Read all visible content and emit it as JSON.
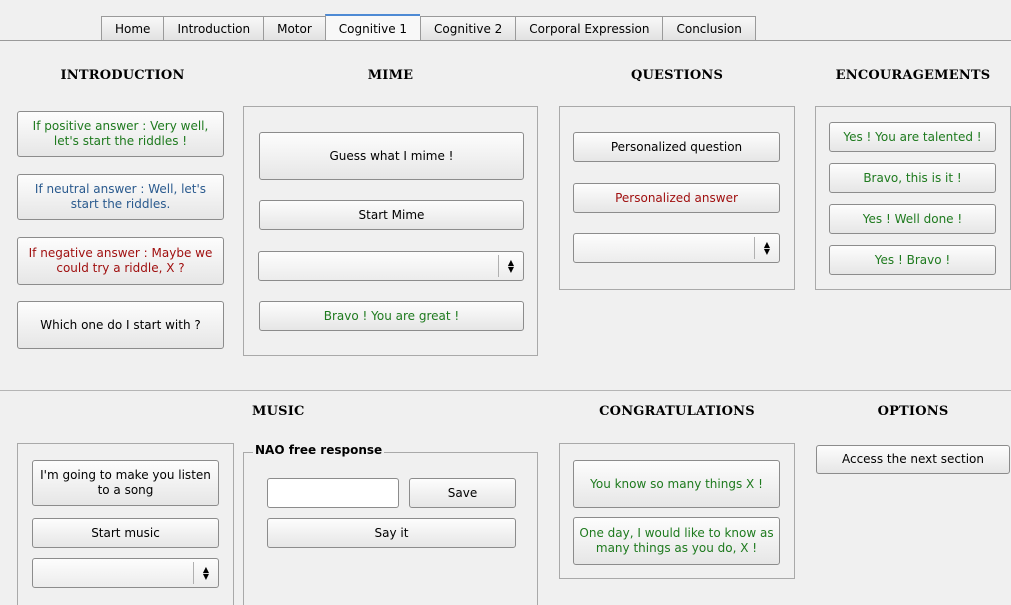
{
  "tabs": [
    {
      "label": "Home",
      "active": false
    },
    {
      "label": "Introduction",
      "active": false
    },
    {
      "label": "Motor",
      "active": false
    },
    {
      "label": "Cognitive 1",
      "active": true
    },
    {
      "label": "Cognitive 2",
      "active": false
    },
    {
      "label": "Corporal Expression",
      "active": false
    },
    {
      "label": "Conclusion",
      "active": false
    }
  ],
  "headings": {
    "introduction": "INTRODUCTION",
    "mime": "MIME",
    "questions": "QUESTIONS",
    "encouragements": "ENCOURAGEMENTS",
    "music": "MUSIC",
    "congratulations": "CONGRATULATIONS",
    "options": "OPTIONS"
  },
  "introduction": {
    "positive": "If positive answer : Very well, let's start the riddles !",
    "neutral": "If neutral answer : Well, let's start the riddles.",
    "negative": "If negative answer : Maybe we could try a riddle, X ?",
    "which_one": "Which one do I start with ?"
  },
  "mime": {
    "guess": "Guess what I mime !",
    "start": "Start Mime",
    "combo_value": "",
    "bravo": "Bravo ! You are great !"
  },
  "questions": {
    "personalized_question": "Personalized question",
    "personalized_answer": "Personalized answer",
    "combo_value": ""
  },
  "encouragements": {
    "items": [
      "Yes ! You are talented !",
      "Bravo, this is it !",
      "Yes ! Well done !",
      "Yes ! Bravo !"
    ]
  },
  "music": {
    "listen": "I'm going to make you listen to a song",
    "start": "Start music",
    "combo_value": ""
  },
  "free_response": {
    "title": "NAO free response",
    "input_value": "",
    "save": "Save",
    "say": "Say it"
  },
  "congratulations": {
    "know_many": "You know so many things X !",
    "one_day": "One day, I would like to know as many things as you do, X !"
  },
  "options": {
    "next": "Access the next section"
  },
  "colors": {
    "green_text": "#1e7a1e",
    "blue_text": "#2a5a8e",
    "red_text": "#a01010",
    "active_tab_accent": "#4d8ad4"
  }
}
